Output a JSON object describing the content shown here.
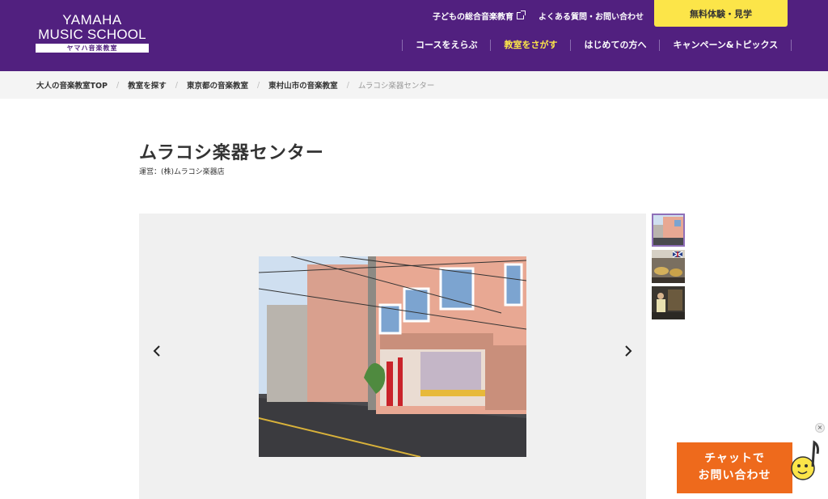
{
  "logo": {
    "line1": "YAMAHA",
    "line2": "MUSIC SCHOOL",
    "line3": "ヤマハ音楽教室"
  },
  "util_links": [
    {
      "label": "子どもの総合音楽教育",
      "icon": "external-link-icon"
    },
    {
      "label": "よくある質問・お問い合わせ"
    }
  ],
  "cta": {
    "label": "無料体験・見学"
  },
  "gnav": [
    {
      "label": "コースをえらぶ",
      "active": false
    },
    {
      "label": "教室をさがす",
      "active": true
    },
    {
      "label": "はじめての方へ",
      "active": false
    },
    {
      "label": "キャンペーン&トピックス",
      "active": false
    }
  ],
  "breadcrumb": [
    "大人の音楽教室TOP",
    "教室を探す",
    "東京都の音楽教室",
    "東村山市の音楽教室",
    "ムラコシ楽器センター"
  ],
  "page": {
    "title": "ムラコシ楽器センター",
    "operator": "運営：(株)ムラコシ楽器店"
  },
  "gallery": {
    "thumb_count": 3,
    "active_index": 0
  },
  "chat": {
    "line1": "チャットで",
    "line2": "お問い合わせ",
    "close": "×"
  },
  "colors": {
    "brand_purple": "#51207f",
    "accent_yellow": "#fce549",
    "chat_orange": "#ee6a1c"
  }
}
